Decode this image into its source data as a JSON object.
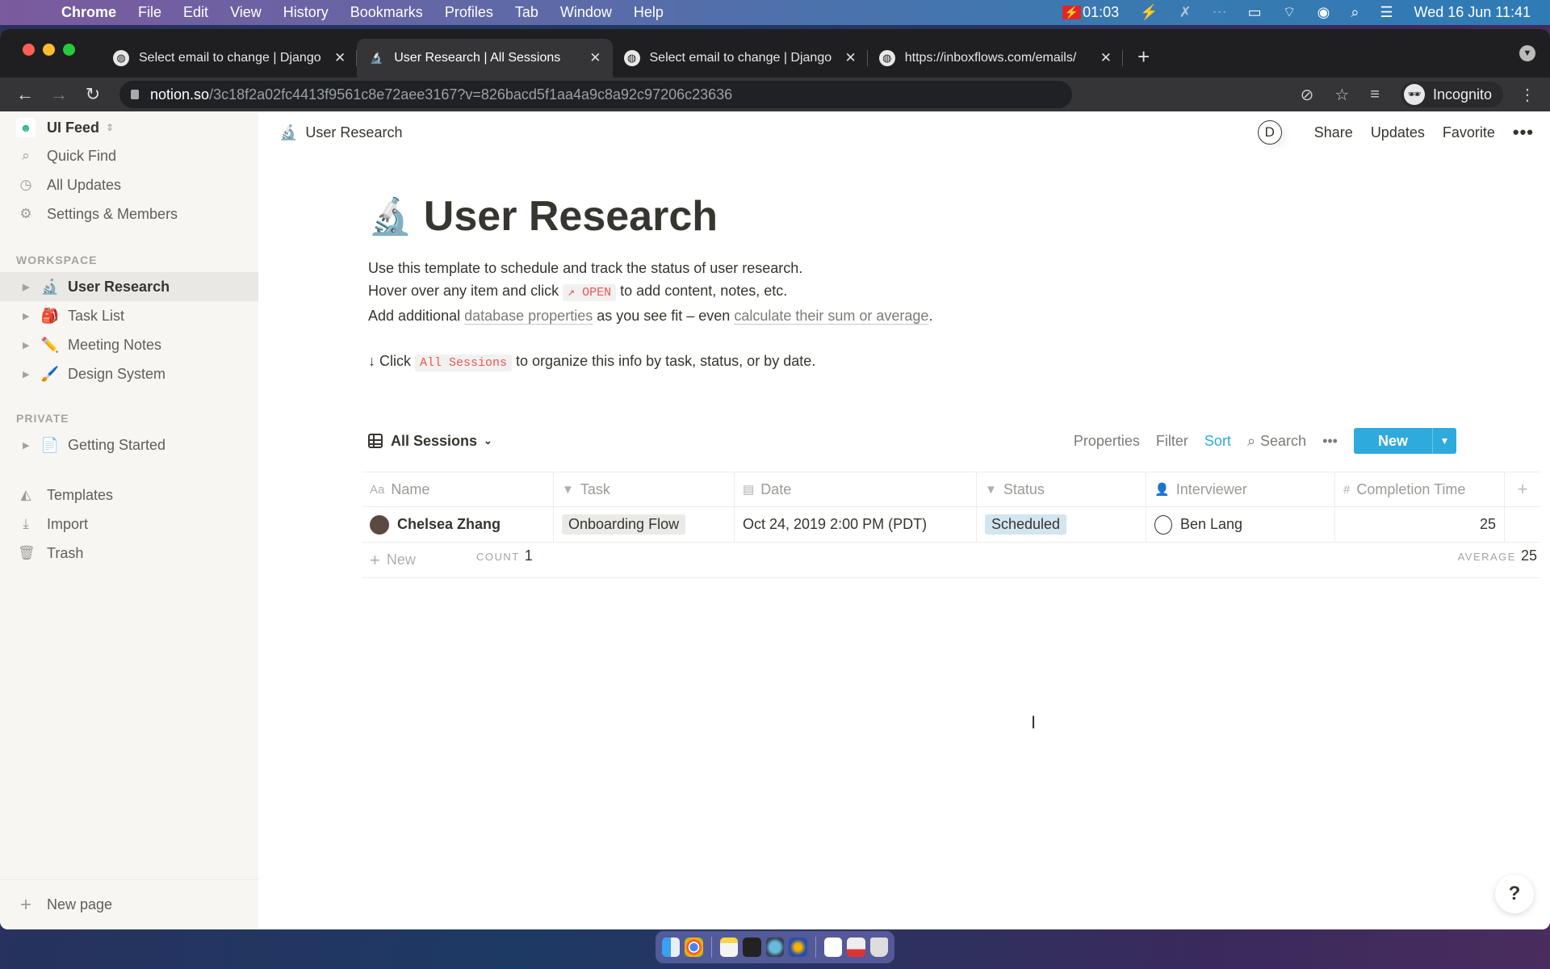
{
  "menubar": {
    "app": "Chrome",
    "items": [
      "File",
      "Edit",
      "View",
      "History",
      "Bookmarks",
      "Profiles",
      "Tab",
      "Window",
      "Help"
    ],
    "recording_time": "01:03",
    "datetime": "Wed 16 Jun  11:41"
  },
  "browser": {
    "tabs": [
      {
        "title": "Select email to change | Django",
        "icon": "globe-icon",
        "active": false
      },
      {
        "title": "User Research | All Sessions",
        "icon": "microscope-icon",
        "active": true
      },
      {
        "title": "Select email to change | Django",
        "icon": "globe-icon",
        "active": false
      },
      {
        "title": "https://inboxflows.com/emails/",
        "icon": "globe-icon",
        "active": false
      }
    ],
    "url_host": "notion.so",
    "url_path": "/3c18f2a02fc4413f9561c8e72aee3167?v=826bacd5f1aa4a9c8a92c97206c23636",
    "profile_label": "Incognito"
  },
  "sidebar": {
    "workspace": "UI Feed",
    "nav": [
      {
        "label": "Quick Find",
        "icon": "search-icon"
      },
      {
        "label": "All Updates",
        "icon": "clock-icon"
      },
      {
        "label": "Settings & Members",
        "icon": "gear-icon"
      }
    ],
    "workspace_label": "WORKSPACE",
    "workspace_pages": [
      {
        "label": "User Research",
        "emoji": "🔬",
        "active": true
      },
      {
        "label": "Task List",
        "emoji": "🎒",
        "active": false
      },
      {
        "label": "Meeting Notes",
        "emoji": "✏️",
        "active": false
      },
      {
        "label": "Design System",
        "emoji": "🖌️",
        "active": false
      }
    ],
    "private_label": "PRIVATE",
    "private_pages": [
      {
        "label": "Getting Started",
        "emoji": "📄"
      }
    ],
    "tools": [
      {
        "label": "Templates",
        "icon": "templates-icon"
      },
      {
        "label": "Import",
        "icon": "import-icon"
      },
      {
        "label": "Trash",
        "icon": "trash-icon"
      }
    ],
    "new_page": "New page"
  },
  "topbar": {
    "breadcrumb": "User Research",
    "avatar_letter": "D",
    "share": "Share",
    "updates": "Updates",
    "favorite": "Favorite"
  },
  "page": {
    "emoji": "🔬",
    "title": "User Research",
    "line1": "Use this template to schedule and track the status of user research.",
    "line2_pre": "Hover over any item and click ",
    "line2_code": "↗ OPEN",
    "line2_post": " to add content, notes, etc.",
    "line3_pre": "Add additional ",
    "line3_link1": "database properties",
    "line3_mid": " as you see fit – even ",
    "line3_link2": "calculate their sum or average",
    "line3_post": ".",
    "line4_pre": "↓ Click ",
    "line4_code": "All Sessions",
    "line4_post": " to organize this info by task, status, or by date."
  },
  "view": {
    "name": "All Sessions",
    "properties": "Properties",
    "filter": "Filter",
    "sort": "Sort",
    "search": "Search",
    "new": "New"
  },
  "table": {
    "columns": [
      {
        "label": "Name",
        "icon": "text-icon"
      },
      {
        "label": "Task",
        "icon": "select-icon"
      },
      {
        "label": "Date",
        "icon": "calendar-icon"
      },
      {
        "label": "Status",
        "icon": "select-icon"
      },
      {
        "label": "Interviewer",
        "icon": "person-icon"
      },
      {
        "label": "Completion Time",
        "icon": "number-icon"
      }
    ],
    "rows": [
      {
        "name": "Chelsea Zhang",
        "task": "Onboarding Flow",
        "date": "Oct 24, 2019 2:00 PM (PDT)",
        "status": "Scheduled",
        "interviewer": "Ben Lang",
        "completion_time": "25"
      }
    ],
    "new_row": "New",
    "count_label": "COUNT",
    "count_value": "1",
    "average_label": "AVERAGE",
    "average_value": "25"
  },
  "colors": {
    "accent": "#2eaadc",
    "code_red": "#eb5757",
    "status_blue": "#d3e5ef"
  }
}
